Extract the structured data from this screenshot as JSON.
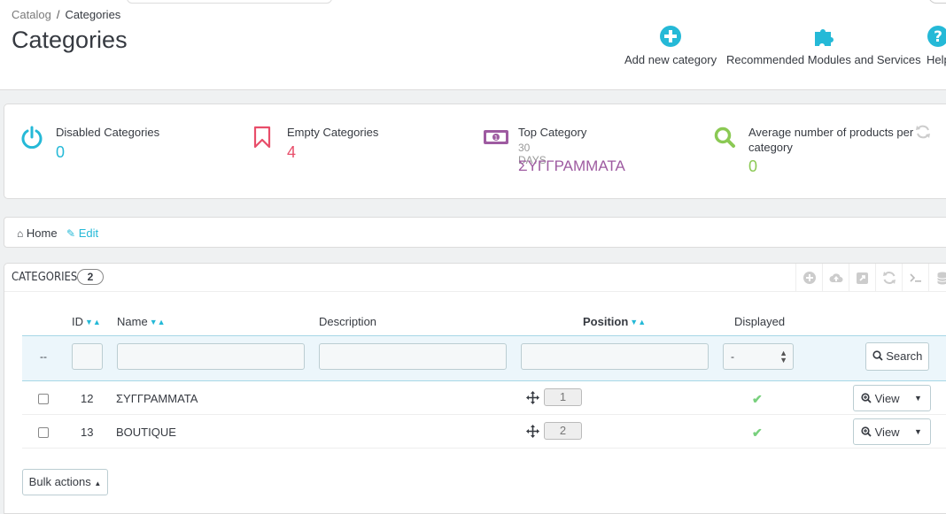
{
  "header": {
    "breadcrumb": {
      "parent": "Catalog",
      "separator": "/",
      "current": "Categories"
    },
    "title": "Categories",
    "toolbar": [
      {
        "label": "Add new category",
        "icon": "plus-circle-icon"
      },
      {
        "label": "Recommended Modules and Services",
        "icon": "puzzle-icon"
      },
      {
        "label": "Help",
        "icon": "help-icon"
      }
    ]
  },
  "kpis": [
    {
      "label": "Disabled Categories",
      "value": "0",
      "icon": "power-icon",
      "color": "#25b9d7"
    },
    {
      "label": "Empty Categories",
      "value": "4",
      "icon": "bookmark-icon",
      "color": "#e84e6a"
    },
    {
      "label": "Top Category",
      "sub": "30 DAYS",
      "value": "ΣΥΓΓΡΑΜΜΑΤΑ",
      "icon": "money-icon",
      "color": "#9e5ba1"
    },
    {
      "label": "Average number of products per",
      "label2": "category",
      "value": "0",
      "icon": "search-icon",
      "color": "#8bc954"
    }
  ],
  "nav": {
    "home": "Home",
    "edit": "Edit"
  },
  "categories_panel": {
    "title": "Categories",
    "count": "2",
    "columns": {
      "id": "ID",
      "name": "Name",
      "description": "Description",
      "position": "Position",
      "displayed": "Displayed"
    },
    "filter": {
      "dash": "--",
      "displayed_select": "-",
      "search": "Search"
    },
    "rows": [
      {
        "id": "12",
        "name": "ΣΥΓΓΡΑΜΜΑΤΑ",
        "position": "1",
        "displayed": "✔",
        "action": "View"
      },
      {
        "id": "13",
        "name": "BOUTIQUE",
        "position": "2",
        "displayed": "✔",
        "action": "View"
      }
    ],
    "bulk_actions": "Bulk actions"
  },
  "colors": {
    "accent": "#25b9d7",
    "pink": "#e84e6a",
    "purple": "#9e5ba1",
    "green": "#8bc954"
  }
}
